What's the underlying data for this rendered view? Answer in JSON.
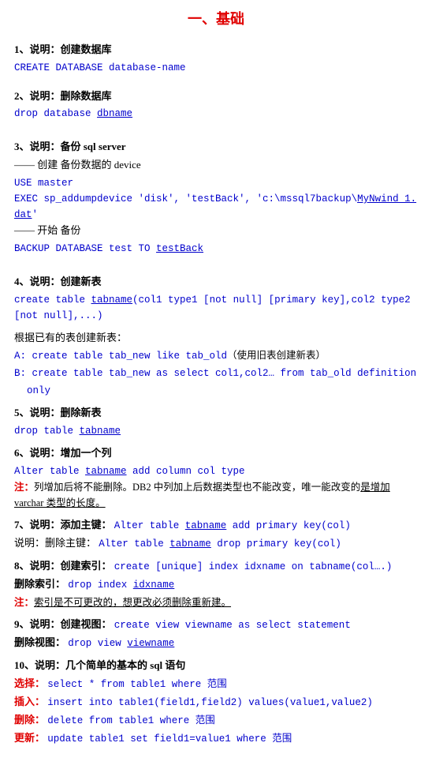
{
  "title": "一、基础",
  "sections": [
    {
      "id": "s1",
      "header": "1、说明：创建数据库",
      "lines": [
        {
          "type": "code",
          "text": "CREATE DATABASE database-name",
          "underline": false
        }
      ]
    },
    {
      "id": "s2",
      "header": "2、说明：删除数据库",
      "lines": [
        {
          "type": "code",
          "text": "drop database dbname",
          "underline": "dbname"
        }
      ]
    },
    {
      "id": "s3",
      "header": "3、说明：备份 sql server",
      "sub": [
        {
          "type": "comment",
          "text": "—— 创建 备份数据的 device"
        },
        {
          "type": "code",
          "text": "USE master",
          "underline": false
        },
        {
          "type": "code",
          "text": "EXEC sp_addumpdevice 'disk', 'testBack', 'c:\\mssql7backup\\MyNwind_1.dat'",
          "underline": false
        },
        {
          "type": "comment",
          "text": "—— 开始 备份"
        },
        {
          "type": "code",
          "text": "BACKUP DATABASE test TO testBack",
          "underline": "testBack"
        }
      ]
    },
    {
      "id": "s4",
      "header": "4、说明：创建新表",
      "lines": [
        {
          "type": "code",
          "text": "create table tabname(col1 type1 [not null] [primary key],col2 type2 [not null],...)"
        }
      ],
      "sub2": [
        {
          "type": "plain",
          "text": "根据已有的表创建新表："
        },
        {
          "type": "code-ab",
          "label": "A:",
          "text": "create table tab_new like tab_old（使用旧表创建新表）"
        },
        {
          "type": "code-ab-long",
          "label": "B:",
          "text": "create table tab_new as select col1,col2… from tab_old definition only"
        }
      ]
    },
    {
      "id": "s5",
      "header": "5、说明：删除新表",
      "lines": [
        {
          "type": "code",
          "text": "drop table tabname",
          "underline": "tabname"
        }
      ]
    },
    {
      "id": "s6",
      "header": "6、说明：增加一个列",
      "lines": [
        {
          "type": "code",
          "text": "Alter table tabname add column col type",
          "underline": "tabname"
        }
      ],
      "note": "注：列增加后将不能删除。DB2 中列加上后数据类型也不能改变，唯一能改变的是增加 varchar 类型的长度。",
      "note_underline": "varchar 类型的长度。"
    },
    {
      "id": "s7",
      "header": "7、说明：添加主键：",
      "inline_code": "Alter table tabname add primary key(col)",
      "inline_underline": "tabname",
      "sub_header": "说明：删除主键：",
      "sub_inline_code": "Alter table tabname drop primary key(col)",
      "sub_inline_underline": "tabname"
    },
    {
      "id": "s8",
      "header": "8、说明：创建索引：",
      "inline_code": "create [unique] index idxname on tabname(col….)",
      "del_label": "删除索引：",
      "del_code": "drop index idxname",
      "del_underline": "idxname",
      "note": "注：索引是不可更改的，想更改必须删除重新建。",
      "note_underline": "索引是不可更改的，想更改必须删除重新建。"
    },
    {
      "id": "s9",
      "header": "9、说明：创建视图：",
      "inline_code": "create view viewname as select statement",
      "del_label": "删除视图：",
      "del_code": "drop view viewname",
      "del_underline": "viewname"
    },
    {
      "id": "s10",
      "header": "10、说明：几个简单的基本的 sql 语句",
      "items": [
        {
          "label": "选择：",
          "code": "select * from table1 where 范围"
        },
        {
          "label": "插入：",
          "code": "insert into table1(field1,field2) values(value1,value2)"
        },
        {
          "label": "删除：",
          "code": "delete from table1 where 范围"
        },
        {
          "label": "更新：",
          "code": "update table1 set field1=value1 where 范围"
        }
      ]
    }
  ]
}
